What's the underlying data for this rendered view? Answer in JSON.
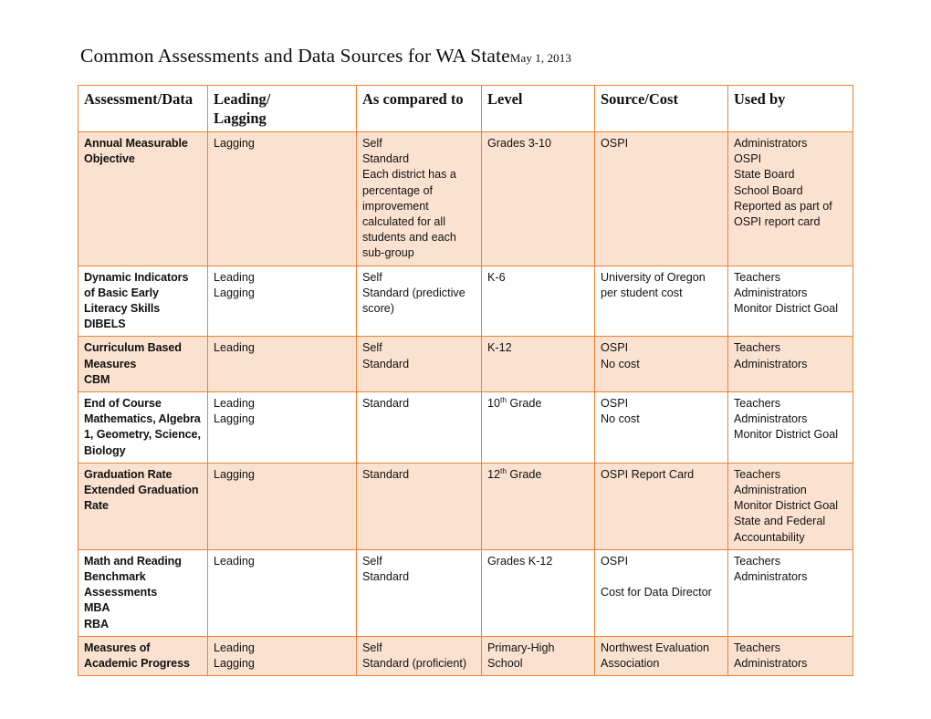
{
  "document": {
    "title": "Common Assessments and Data Sources for WA State",
    "date": "May 1, 2013"
  },
  "colors": {
    "border": "#ED8137",
    "shaded_row": "#FBE2D0",
    "plain_row": "#FFFFFF",
    "text": "#111111"
  },
  "table": {
    "headers": [
      "Assessment/Data",
      "Leading/\nLagging",
      "As compared to",
      "Level",
      "Source/Cost",
      "Used by"
    ],
    "rows": [
      {
        "shaded": true,
        "assessment": "Annual Measurable Objective",
        "leading_lagging": "Lagging",
        "as_compared_to": "Self\nStandard\nEach district has a percentage of improvement calculated for all students and each sub-group",
        "level": "Grades 3-10",
        "source_cost": "OSPI",
        "used_by": "Administrators\nOSPI\nState Board\nSchool Board\nReported as part of OSPI report card",
        "level_valign": "middle",
        "source_valign": "middle",
        "usedby_valign": "top"
      },
      {
        "shaded": false,
        "assessment": "Dynamic Indicators of Basic Early Literacy Skills\nDIBELS",
        "leading_lagging": "Leading\nLagging",
        "as_compared_to": "Self\nStandard (predictive score)",
        "level": "K-6",
        "source_cost": "University of Oregon per student cost",
        "used_by": "Teachers\nAdministrators\nMonitor District Goal",
        "level_valign": "top",
        "source_valign": "top",
        "usedby_valign": "top"
      },
      {
        "shaded": true,
        "assessment": "Curriculum Based Measures\nCBM",
        "leading_lagging": "Leading",
        "as_compared_to": "Self\nStandard",
        "level": "K-12",
        "source_cost": "OSPI\nNo cost",
        "used_by": "Teachers\nAdministrators",
        "level_valign": "top",
        "source_valign": "top",
        "usedby_valign": "top"
      },
      {
        "shaded": false,
        "assessment": "End of Course Mathematics, Algebra 1, Geometry, Science, Biology",
        "leading_lagging": "Leading\nLagging",
        "as_compared_to": "Standard",
        "level": "10th Grade",
        "level_sup": "th",
        "level_prefix": "10",
        "level_suffix": " Grade",
        "source_cost": "OSPI\nNo cost",
        "used_by": "Teachers\nAdministrators\nMonitor District Goal",
        "level_valign": "middle",
        "source_valign": "middle",
        "usedby_valign": "middle"
      },
      {
        "shaded": true,
        "assessment": "Graduation Rate Extended Graduation Rate",
        "leading_lagging": "Lagging",
        "as_compared_to": "Standard",
        "level": "12th Grade",
        "level_sup": "th",
        "level_prefix": "12",
        "level_suffix": " Grade",
        "source_cost": "OSPI Report Card",
        "used_by": "Teachers\nAdministration\nMonitor District Goal\nState and Federal Accountability",
        "level_valign": "top",
        "source_valign": "top",
        "usedby_valign": "top"
      },
      {
        "shaded": false,
        "assessment": "Math and Reading Benchmark Assessments\nMBA\nRBA",
        "leading_lagging": "Leading",
        "as_compared_to": "Self\nStandard",
        "level": "Grades K-12",
        "source_cost": "OSPI\n\nCost for Data Director",
        "used_by": "Teachers\nAdministrators",
        "level_valign": "top",
        "source_valign": "top",
        "usedby_valign": "middle"
      },
      {
        "shaded": true,
        "assessment": "Measures of Academic Progress",
        "leading_lagging": "Leading\nLagging",
        "as_compared_to": "Self\nStandard (proficient)",
        "level": "Primary-High School",
        "source_cost": "Northwest Evaluation Association",
        "used_by": "Teachers\nAdministrators",
        "level_valign": "top",
        "source_valign": "top",
        "usedby_valign": "top"
      }
    ]
  }
}
